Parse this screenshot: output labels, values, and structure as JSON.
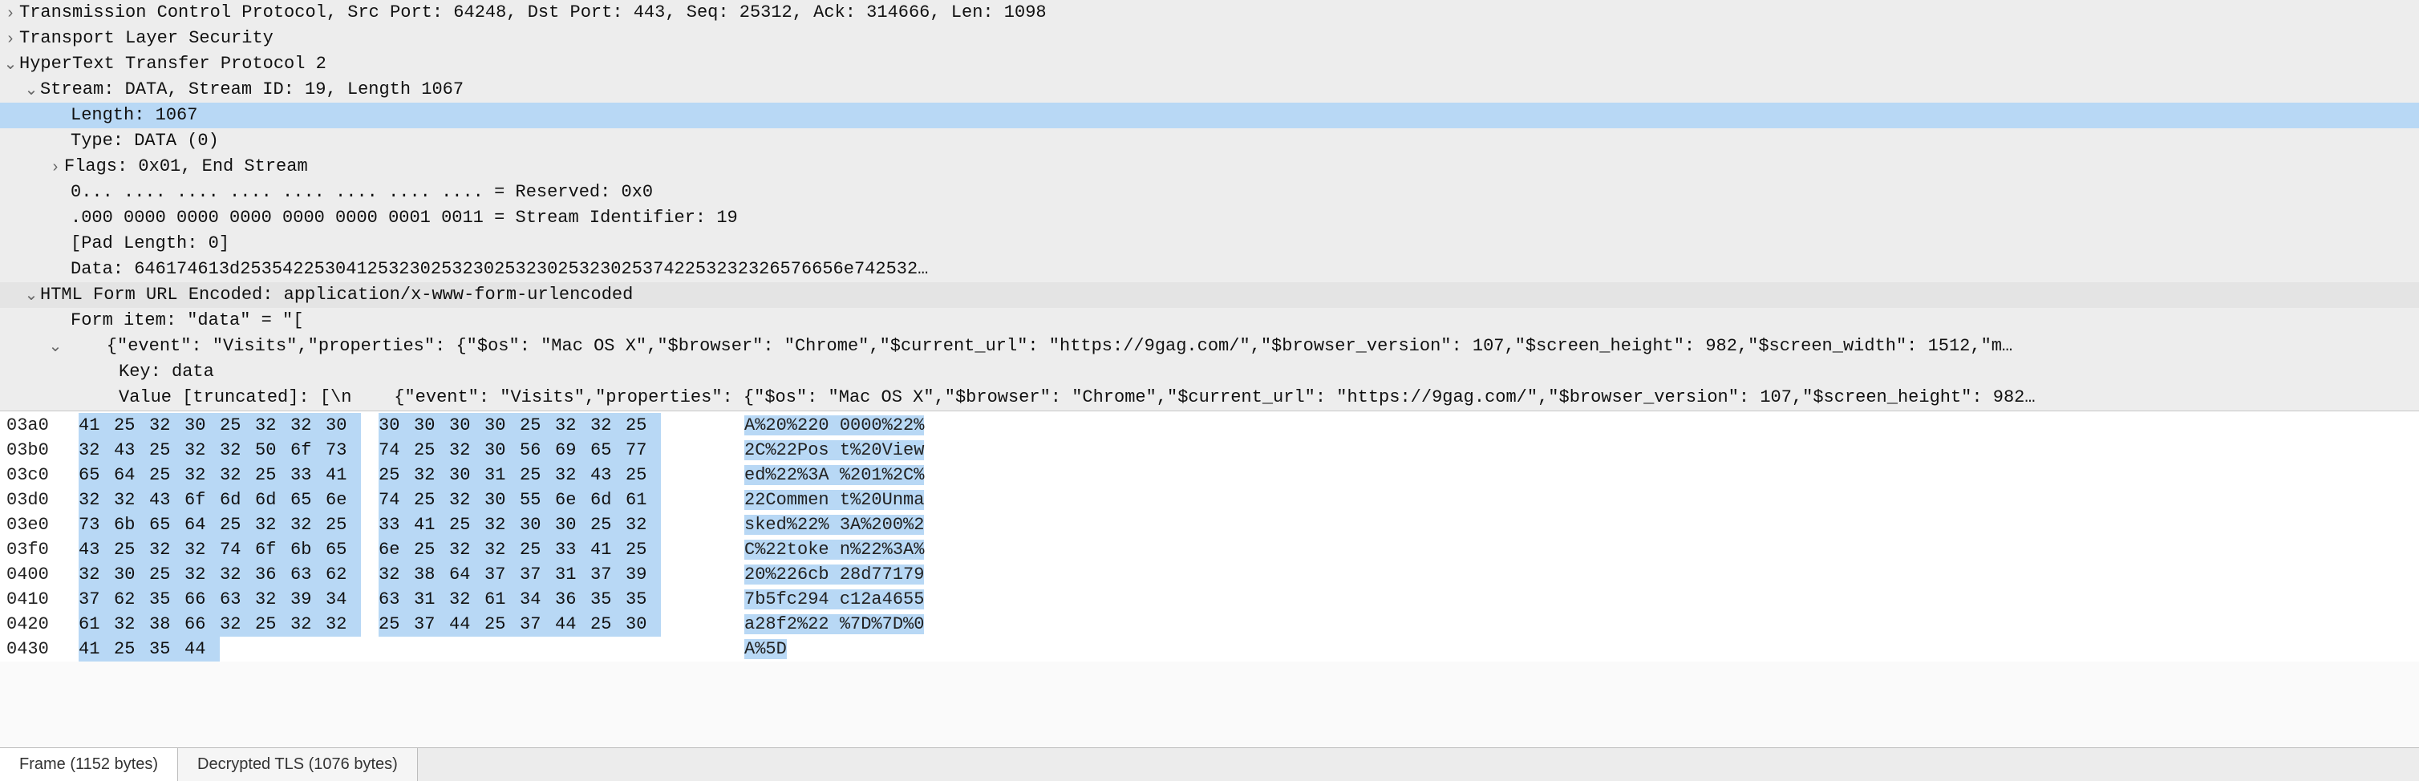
{
  "tree": {
    "tcp_header": "Transmission Control Protocol, Src Port: 64248, Dst Port: 443, Seq: 25312, Ack: 314666, Len: 1098",
    "tls_header": "Transport Layer Security",
    "http2_header": "HyperText Transfer Protocol 2",
    "stream_line": "Stream: DATA, Stream ID: 19, Length 1067",
    "length_line": "Length: 1067",
    "type_line": "Type: DATA (0)",
    "flags_line": "Flags: 0x01, End Stream",
    "reserved_line": "0... .... .... .... .... .... .... .... = Reserved: 0x0",
    "stream_id_line": ".000 0000 0000 0000 0000 0000 0001 0011 = Stream Identifier: 19",
    "pad_length_line": "[Pad Length: 0]",
    "data_line": "Data: 646174613d253542253041253230253230253230253230253742253232326576656e742532…",
    "form_header": "HTML Form URL Encoded: application/x-www-form-urlencoded",
    "form_item_line1": "Form item: \"data\" = \"[",
    "form_item_line2": "    {\"event\": \"Visits\",\"properties\": {\"$os\": \"Mac OS X\",\"$browser\": \"Chrome\",\"$current_url\": \"https://9gag.com/\",\"$browser_version\": 107,\"$screen_height\": 982,\"$screen_width\": 1512,\"m…",
    "key_line": "Key: data",
    "value_line": "Value [truncated]: [\\n    {\"event\": \"Visits\",\"properties\": {\"$os\": \"Mac OS X\",\"$browser\": \"Chrome\",\"$current_url\": \"https://9gag.com/\",\"$browser_version\": 107,\"$screen_height\": 982…"
  },
  "hex": {
    "rows": [
      {
        "off": "03a0",
        "b": [
          "41",
          "25",
          "32",
          "30",
          "25",
          "32",
          "32",
          "30",
          "30",
          "30",
          "30",
          "30",
          "25",
          "32",
          "32",
          "25"
        ],
        "a": "A%20%220 0000%22%"
      },
      {
        "off": "03b0",
        "b": [
          "32",
          "43",
          "25",
          "32",
          "32",
          "50",
          "6f",
          "73",
          "74",
          "25",
          "32",
          "30",
          "56",
          "69",
          "65",
          "77"
        ],
        "a": "2C%22Pos t%20View"
      },
      {
        "off": "03c0",
        "b": [
          "65",
          "64",
          "25",
          "32",
          "32",
          "25",
          "33",
          "41",
          "25",
          "32",
          "30",
          "31",
          "25",
          "32",
          "43",
          "25"
        ],
        "a": "ed%22%3A %201%2C%"
      },
      {
        "off": "03d0",
        "b": [
          "32",
          "32",
          "43",
          "6f",
          "6d",
          "6d",
          "65",
          "6e",
          "74",
          "25",
          "32",
          "30",
          "55",
          "6e",
          "6d",
          "61"
        ],
        "a": "22Commen t%20Unma"
      },
      {
        "off": "03e0",
        "b": [
          "73",
          "6b",
          "65",
          "64",
          "25",
          "32",
          "32",
          "25",
          "33",
          "41",
          "25",
          "32",
          "30",
          "30",
          "25",
          "32"
        ],
        "a": "sked%22% 3A%200%2"
      },
      {
        "off": "03f0",
        "b": [
          "43",
          "25",
          "32",
          "32",
          "74",
          "6f",
          "6b",
          "65",
          "6e",
          "25",
          "32",
          "32",
          "25",
          "33",
          "41",
          "25"
        ],
        "a": "C%22toke n%22%3A%"
      },
      {
        "off": "0400",
        "b": [
          "32",
          "30",
          "25",
          "32",
          "32",
          "36",
          "63",
          "62",
          "32",
          "38",
          "64",
          "37",
          "37",
          "31",
          "37",
          "39"
        ],
        "a": "20%226cb 28d77179"
      },
      {
        "off": "0410",
        "b": [
          "37",
          "62",
          "35",
          "66",
          "63",
          "32",
          "39",
          "34",
          "63",
          "31",
          "32",
          "61",
          "34",
          "36",
          "35",
          "35"
        ],
        "a": "7b5fc294 c12a4655"
      },
      {
        "off": "0420",
        "b": [
          "61",
          "32",
          "38",
          "66",
          "32",
          "25",
          "32",
          "32",
          "25",
          "37",
          "44",
          "25",
          "37",
          "44",
          "25",
          "30"
        ],
        "a": "a28f2%22 %7D%7D%0"
      },
      {
        "off": "0430",
        "b": [
          "41",
          "25",
          "35",
          "44",
          "",
          "",
          "",
          "",
          "",
          "",
          "",
          "",
          "",
          "",
          "",
          ""
        ],
        "a": "A%5D"
      }
    ]
  },
  "tabs": {
    "frame": "Frame (1152 bytes)",
    "decrypted": "Decrypted TLS (1076 bytes)"
  }
}
